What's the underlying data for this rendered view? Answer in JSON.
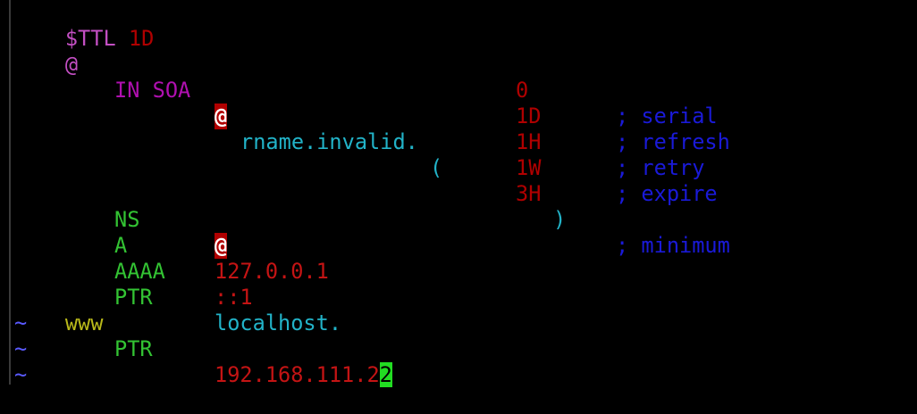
{
  "editor": {
    "lines": {
      "ttl": {
        "directive": "$TTL",
        "value": "1D"
      },
      "soa": {
        "owner": "@",
        "class_type": "IN SOA",
        "mname": "@",
        "rname": "rname.invalid.",
        "open_paren": "("
      },
      "serial": {
        "value": "0",
        "comment": "; serial"
      },
      "refresh": {
        "value": "1D",
        "comment": "; refresh"
      },
      "retry": {
        "value": "1H",
        "comment": "; retry"
      },
      "expire": {
        "value": "1W",
        "comment": "; expire"
      },
      "minimum": {
        "value": "3H",
        "close_paren": ")",
        "comment": "; minimum"
      },
      "ns": {
        "type": "NS",
        "data": "@"
      },
      "a": {
        "type": "A",
        "data": "127.0.0.1"
      },
      "aaaa": {
        "type": "AAAA",
        "data": "::1"
      },
      "ptr1": {
        "type": "PTR",
        "data": "localhost."
      },
      "ptr2": {
        "owner": "www",
        "type": "PTR",
        "data_before_cursor": "192.168.111.2",
        "cursor_char": "2"
      }
    },
    "empty_line_marker": "~"
  },
  "colors": {
    "background": "#000000",
    "magenta": "#c34fc3",
    "red": "#c41414",
    "green": "#33c333",
    "cyan": "#22b3c8",
    "blue": "#1a1ad9",
    "yellow": "#b9b91a",
    "cursor": "#22dd22",
    "tilde": "#5a5aff"
  }
}
